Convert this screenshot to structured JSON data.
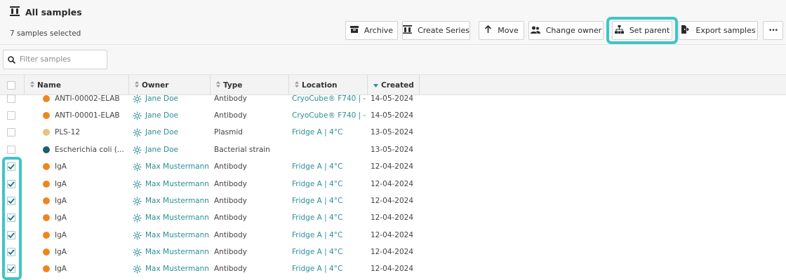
{
  "header": {
    "title": "All samples",
    "selected_count": "7 samples selected"
  },
  "toolbar": {
    "archive": "Archive",
    "create_series": "Create Series",
    "move": "Move",
    "change_owner": "Change owner",
    "set_parent": "Set parent",
    "export_samples": "Export samples",
    "more": "•••"
  },
  "filter": {
    "placeholder": "Filter samples"
  },
  "columns": {
    "name": "Name",
    "owner": "Owner",
    "type": "Type",
    "location": "Location",
    "created": "Created"
  },
  "colors": {
    "accent": "#2a8f98",
    "highlight": "#3fc5c8",
    "antibody": "#f0851d",
    "plasmid": "#e8c47a",
    "bacterial": "#1c5e6e"
  },
  "rows": [
    {
      "name": "ANTI-00002-ELAB",
      "owner": "Jane Doe",
      "type": "Antibody",
      "location": "CryoCube® F740 | -...",
      "created": "14-05-2024",
      "checked": false,
      "dot": "#f0851d"
    },
    {
      "name": "ANTI-00001-ELAB",
      "owner": "Jane Doe",
      "type": "Antibody",
      "location": "CryoCube® F740 | -...",
      "created": "14-05-2024",
      "checked": false,
      "dot": "#f0851d"
    },
    {
      "name": "PLS-12",
      "owner": "Jane Doe",
      "type": "Plasmid",
      "location": "Fridge A | 4°C",
      "created": "13-05-2024",
      "checked": false,
      "dot": "#e8c47a"
    },
    {
      "name": "Escherichia coli (...",
      "owner": "Jane Doe",
      "type": "Bacterial strain",
      "location": "",
      "created": "13-05-2024",
      "checked": false,
      "dot": "#1c5e6e"
    },
    {
      "name": "IgA",
      "owner": "Max Mustermann",
      "type": "Antibody",
      "location": "Fridge A | 4°C",
      "created": "12-04-2024",
      "checked": true,
      "dot": "#f0851d"
    },
    {
      "name": "IgA",
      "owner": "Max Mustermann",
      "type": "Antibody",
      "location": "Fridge A | 4°C",
      "created": "12-04-2024",
      "checked": true,
      "dot": "#f0851d"
    },
    {
      "name": "IgA",
      "owner": "Max Mustermann",
      "type": "Antibody",
      "location": "Fridge A | 4°C",
      "created": "12-04-2024",
      "checked": true,
      "dot": "#f0851d"
    },
    {
      "name": "IgA",
      "owner": "Max Mustermann",
      "type": "Antibody",
      "location": "Fridge A | 4°C",
      "created": "12-04-2024",
      "checked": true,
      "dot": "#f0851d"
    },
    {
      "name": "IgA",
      "owner": "Max Mustermann",
      "type": "Antibody",
      "location": "Fridge A | 4°C",
      "created": "12-04-2024",
      "checked": true,
      "dot": "#f0851d"
    },
    {
      "name": "IgA",
      "owner": "Max Mustermann",
      "type": "Antibody",
      "location": "Fridge A | 4°C",
      "created": "12-04-2024",
      "checked": true,
      "dot": "#f0851d"
    },
    {
      "name": "IgA",
      "owner": "Max Mustermann",
      "type": "Antibody",
      "location": "Fridge A | 4°C",
      "created": "12-04-2024",
      "checked": true,
      "dot": "#f0851d"
    }
  ]
}
